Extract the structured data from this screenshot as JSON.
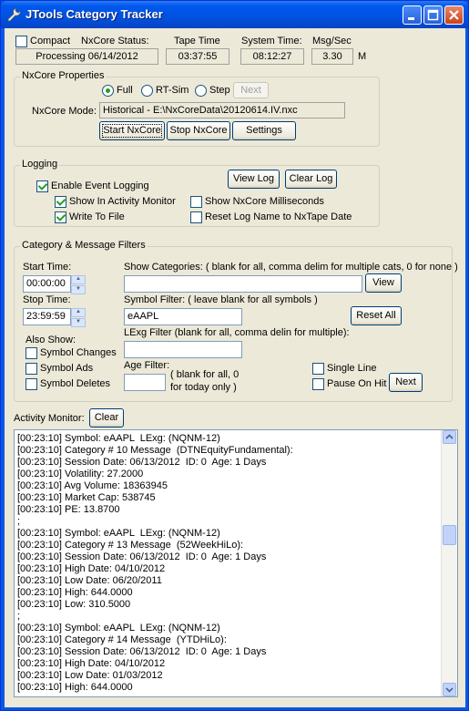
{
  "window": {
    "title": "JTools Category Tracker"
  },
  "status": {
    "compact_label": "Compact",
    "nxcore_status_label": "NxCore Status:",
    "nxcore_status_value": "Processing 06/14/2012",
    "tape_time_label": "Tape Time",
    "tape_time_value": "03:37:55",
    "system_time_label": "System Time:",
    "system_time_value": "08:12:27",
    "msg_sec_label": "Msg/Sec",
    "msg_sec_value": "3.30",
    "msg_sec_unit": "M"
  },
  "properties": {
    "title": "NxCore Properties",
    "mode_full": "Full",
    "mode_rtsim": "RT-Sim",
    "mode_step": "Step",
    "next_label": "Next",
    "mode_label": "NxCore Mode:",
    "mode_value": "Historical - E:\\NxCoreData\\20120614.IV.nxc",
    "start_label": "Start NxCore",
    "stop_label": "Stop NxCore",
    "settings_label": "Settings"
  },
  "logging": {
    "title": "Logging",
    "enable": "Enable Event Logging",
    "show_monitor": "Show In Activity Monitor",
    "write_file": "Write To File",
    "show_ms": "Show NxCore Milliseconds",
    "reset_name": "Reset Log Name to NxTape Date",
    "view_log": "View Log",
    "clear_log": "Clear Log"
  },
  "filters": {
    "title": "Category & Message Filters",
    "start_time_label": "Start Time:",
    "start_time_value": "00:00:00",
    "stop_time_label": "Stop Time:",
    "stop_time_value": "23:59:59",
    "show_categories_label": "Show Categories:  ( blank for all, comma delim for multiple cats, 0 for none )",
    "categories_value": "",
    "view_label": "View",
    "symbol_filter_label": "Symbol Filter: ( leave blank for all symbols )",
    "symbol_value": "eAAPL",
    "reset_all": "Reset All",
    "lexg_filter_label": "LExg Filter (blank for all, comma delin  for multiple):",
    "lexg_value": "",
    "also_show": "Also Show:",
    "symbol_changes": "Symbol Changes",
    "symbol_ads": "Symbol Ads",
    "symbol_deletes": "Symbol Deletes",
    "age_filter_label": "Age Filter:",
    "age_value": "",
    "age_hint_1": "( blank for all, 0",
    "age_hint_2": "for today only )",
    "single_line": "Single Line",
    "pause_on_hit": "Pause On Hit",
    "next_label": "Next"
  },
  "activity": {
    "label": "Activity Monitor:",
    "clear_label": "Clear",
    "lines": [
      "[00:23:10] Symbol: eAAPL  LExg: (NQNM-12)",
      "[00:23:10] Category # 10 Message  (DTNEquityFundamental):",
      "[00:23:10] Session Date: 06/13/2012  ID: 0  Age: 1 Days",
      "[00:23:10] Volatility: 27.2000",
      "[00:23:10] Avg Volume: 18363945",
      "[00:23:10] Market Cap: 538745",
      "[00:23:10] PE: 13.8700",
      ";",
      "[00:23:10] Symbol: eAAPL  LExg: (NQNM-12)",
      "[00:23:10] Category # 13 Message  (52WeekHiLo):",
      "[00:23:10] Session Date: 06/13/2012  ID: 0  Age: 1 Days",
      "[00:23:10] High Date: 04/10/2012",
      "[00:23:10] Low Date: 06/20/2011",
      "[00:23:10] High: 644.0000",
      "[00:23:10] Low: 310.5000",
      ";",
      "[00:23:10] Symbol: eAAPL  LExg: (NQNM-12)",
      "[00:23:10] Category # 14 Message  (YTDHiLo):",
      "[00:23:10] Session Date: 06/13/2012  ID: 0  Age: 1 Days",
      "[00:23:10] High Date: 04/10/2012",
      "[00:23:10] Low Date: 01/03/2012",
      "[00:23:10] High: 644.0000"
    ]
  }
}
